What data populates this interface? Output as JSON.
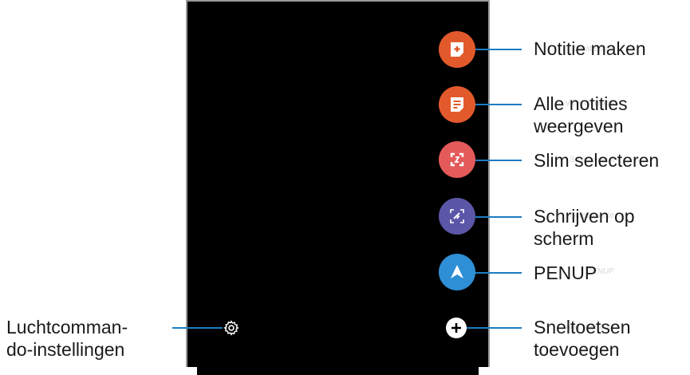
{
  "menu": {
    "items": [
      {
        "label": "Create note",
        "icon": "create-note-icon",
        "color": "#e25a2c"
      },
      {
        "label": "View all notes",
        "icon": "view-notes-icon",
        "color": "#e25a2c"
      },
      {
        "label": "Smart select",
        "icon": "smart-select-icon",
        "color": "#e45a5a"
      },
      {
        "label": "Screen write",
        "icon": "screen-write-icon",
        "color": "#5b56a8"
      },
      {
        "label": "PENUP",
        "icon": "penup-icon",
        "color": "#2f8fd6"
      },
      {
        "label": "Add shortcuts",
        "icon": "plus-icon",
        "color": "#ffffff"
      }
    ],
    "settings_icon": "gear-icon"
  },
  "callouts": {
    "create_note": "Notitie maken",
    "view_all_line1": "Alle notities",
    "view_all_line2": "weergeven",
    "smart_select": "Slim selecteren",
    "screen_write_line1": "Schrijven op",
    "screen_write_line2": "scherm",
    "penup": "PENUP",
    "add_shortcuts_line1": "Sneltoetsen",
    "add_shortcuts_line2": "toevoegen",
    "settings_line1": "Luchtcomman-",
    "settings_line2": "do-instellingen"
  },
  "colors": {
    "leader": "#1d7cc2"
  }
}
